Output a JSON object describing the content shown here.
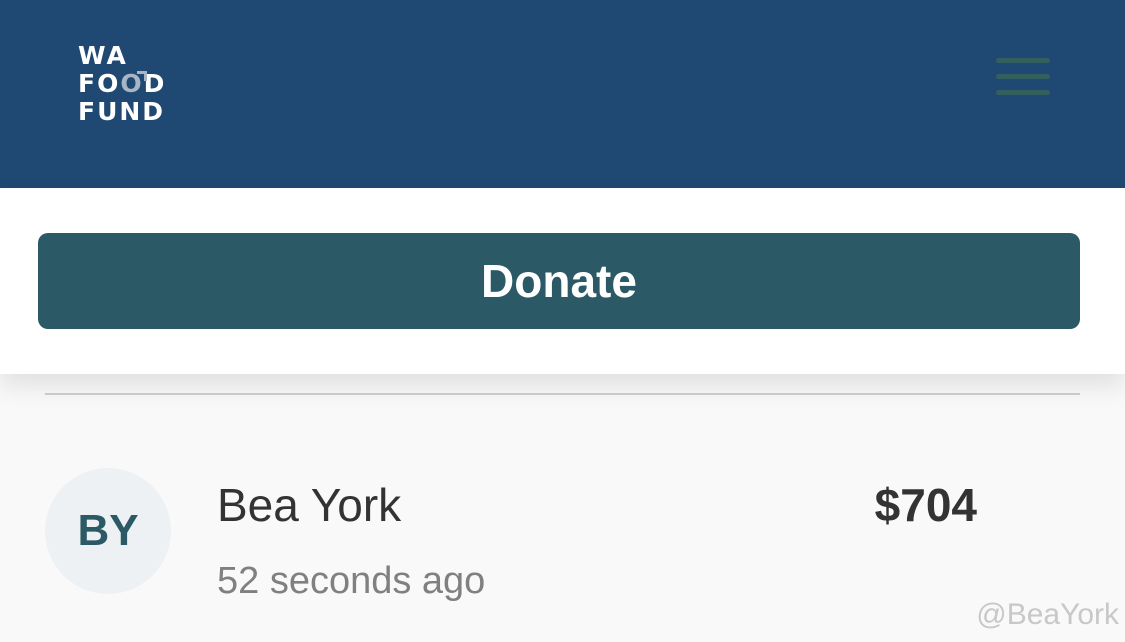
{
  "header": {
    "logo": {
      "line1": "WA",
      "line2_pre": "FO",
      "line2_o": "O",
      "line2_post": "D",
      "line3": "FUND"
    },
    "menu_icon": "hamburger-icon"
  },
  "donate": {
    "label": "Donate"
  },
  "donation": {
    "initials": "BY",
    "name": "Bea York",
    "time": "52 seconds ago",
    "amount": "$704"
  },
  "watermark": "@BeaYork",
  "colors": {
    "header_bg": "#1f4872",
    "button_bg": "#2b5966",
    "menu_bars": "#33605f"
  }
}
